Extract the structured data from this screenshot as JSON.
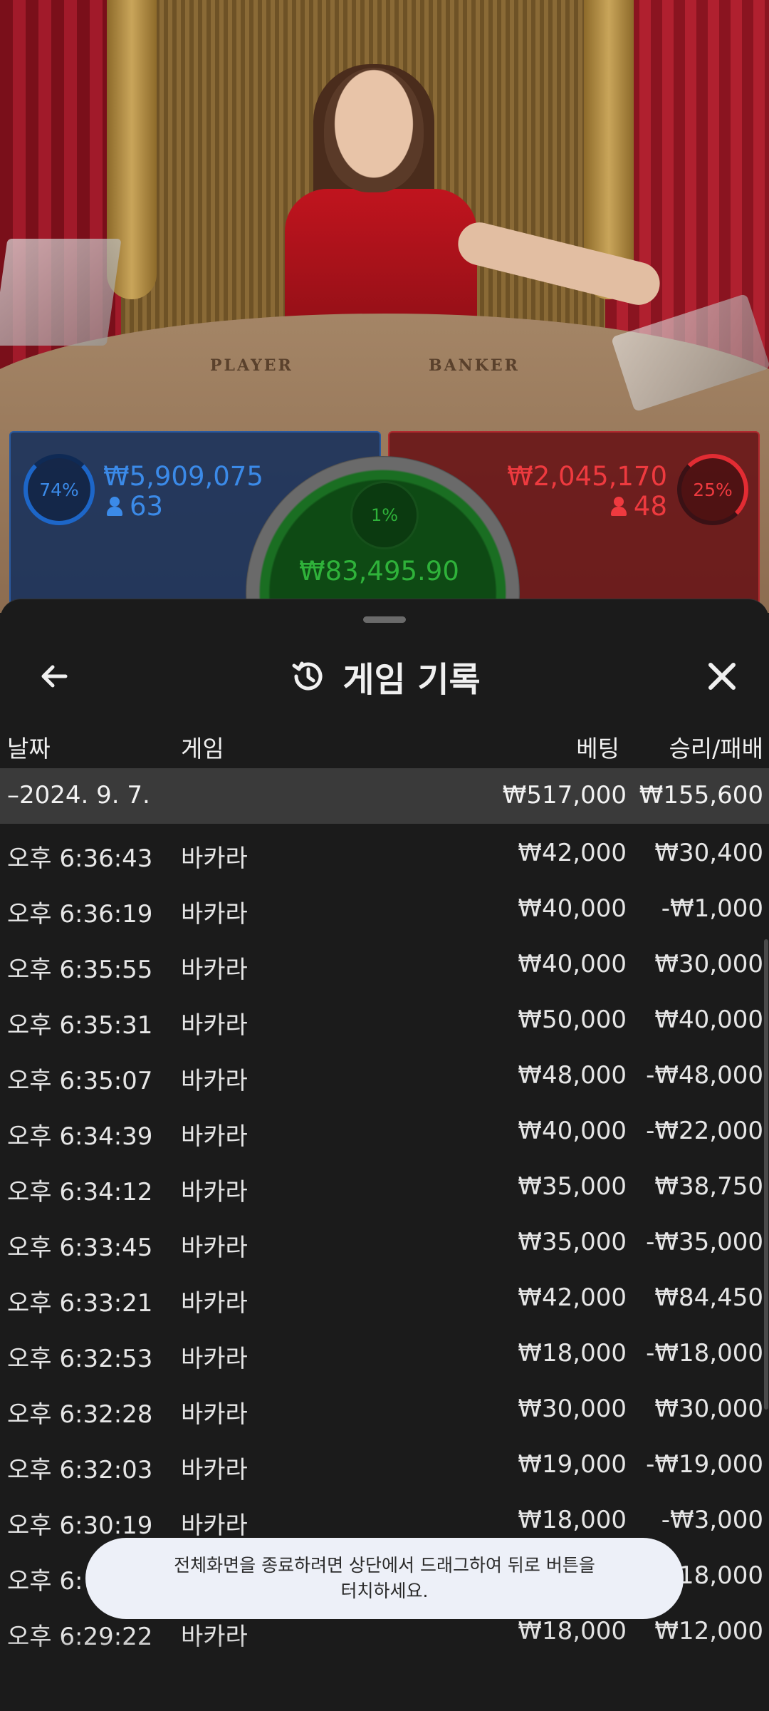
{
  "table_labels": {
    "player": "PLAYER",
    "banker": "BANKER"
  },
  "player_panel": {
    "percent": "74%",
    "amount": "₩5,909,075",
    "count": "63"
  },
  "tie_panel": {
    "percent": "1%",
    "amount": "₩83,495.90"
  },
  "banker_panel": {
    "percent": "25%",
    "amount": "₩2,045,170",
    "count": "48"
  },
  "sheet": {
    "title": "게임 기록",
    "columns": {
      "date": "날짜",
      "game": "게임",
      "bet": "베팅",
      "result": "승리/패배"
    },
    "date_group": {
      "date": "–2024. 9. 7.",
      "bet": "₩517,000",
      "result": "₩155,600"
    },
    "rows": [
      {
        "time": "오후 6:36:43",
        "game": "바카라",
        "bet": "₩42,000",
        "result": "₩30,400"
      },
      {
        "time": "오후 6:36:19",
        "game": "바카라",
        "bet": "₩40,000",
        "result": "-₩1,000"
      },
      {
        "time": "오후 6:35:55",
        "game": "바카라",
        "bet": "₩40,000",
        "result": "₩30,000"
      },
      {
        "time": "오후 6:35:31",
        "game": "바카라",
        "bet": "₩50,000",
        "result": "₩40,000"
      },
      {
        "time": "오후 6:35:07",
        "game": "바카라",
        "bet": "₩48,000",
        "result": "-₩48,000"
      },
      {
        "time": "오후 6:34:39",
        "game": "바카라",
        "bet": "₩40,000",
        "result": "-₩22,000"
      },
      {
        "time": "오후 6:34:12",
        "game": "바카라",
        "bet": "₩35,000",
        "result": "₩38,750"
      },
      {
        "time": "오후 6:33:45",
        "game": "바카라",
        "bet": "₩35,000",
        "result": "-₩35,000"
      },
      {
        "time": "오후 6:33:21",
        "game": "바카라",
        "bet": "₩42,000",
        "result": "₩84,450"
      },
      {
        "time": "오후 6:32:53",
        "game": "바카라",
        "bet": "₩18,000",
        "result": "-₩18,000"
      },
      {
        "time": "오후 6:32:28",
        "game": "바카라",
        "bet": "₩30,000",
        "result": "₩30,000"
      },
      {
        "time": "오후 6:32:03",
        "game": "바카라",
        "bet": "₩19,000",
        "result": "-₩19,000"
      },
      {
        "time": "오후 6:30:19",
        "game": "바카라",
        "bet": "₩18,000",
        "result": "-₩3,000"
      },
      {
        "time": "오후 6:",
        "game": "",
        "bet": "",
        "result": "18,000"
      },
      {
        "time": "오후 6:29:22",
        "game": "바카라",
        "bet": "₩18,000",
        "result": "₩12,000"
      }
    ]
  },
  "toast": {
    "line1": "전체화면을 종료하려면 상단에서 드래그하여 뒤로 버튼을",
    "line2": "터치하세요."
  },
  "colors": {
    "player": "#3b8ae8",
    "banker": "#ee3a3f",
    "tie": "#2fb23a",
    "sheet_bg": "#1b1b1b",
    "date_row": "#3a3a3a"
  },
  "icons": {
    "back": "arrow-left-icon",
    "history": "history-icon",
    "close": "close-icon",
    "person": "person-icon"
  }
}
